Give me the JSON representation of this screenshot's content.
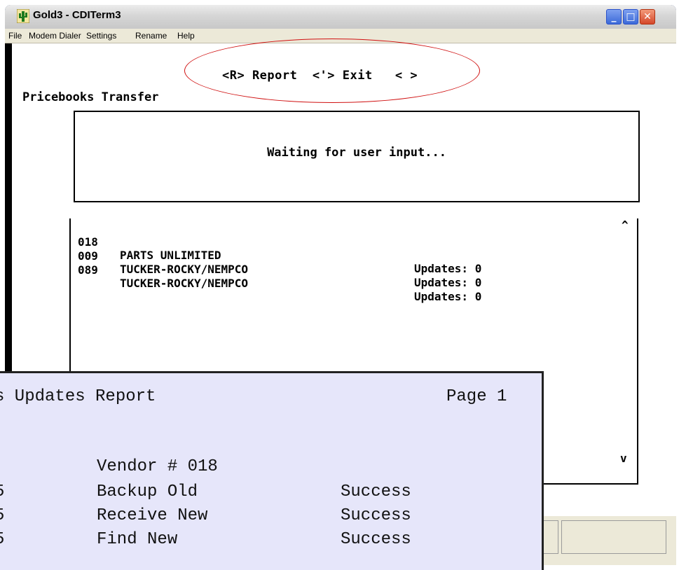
{
  "window": {
    "title": "Gold3 - CDITerm3",
    "controls": [
      "minimize",
      "maximize",
      "close"
    ]
  },
  "menu": [
    "File",
    "Modem Dialer",
    "Settings",
    "Rename",
    "Help"
  ],
  "terminal": {
    "command_line": "<R> Report  <'> Exit   < >",
    "screen_title": "Pricebooks Transfer",
    "status_message": "Waiting for user input...",
    "rows": [
      {
        "number": "018",
        "vendor": "PARTS UNLIMITED",
        "updates": "Updates: 0"
      },
      {
        "number": "009",
        "vendor": "TUCKER-ROCKY/NEMPCO",
        "updates": "Updates: 0"
      },
      {
        "number": "089",
        "vendor": "TUCKER-ROCKY/NEMPCO",
        "updates": "Updates: 0"
      }
    ],
    "scroll_up": "^",
    "scroll_down": "v"
  },
  "report": {
    "title": "s Updates Report",
    "page": "Page 1",
    "vendor_line": "Vendor # 018",
    "lines": [
      {
        "prefix": "5",
        "step": "Backup Old",
        "result": "Success"
      },
      {
        "prefix": "5",
        "step": "Receive New",
        "result": "Success"
      },
      {
        "prefix": "5",
        "step": "Find New",
        "result": "Success"
      }
    ]
  },
  "colors": {
    "annotation": "#d01010",
    "report_background": "#e6e6fa",
    "title_bar": "#d6d6d6"
  }
}
